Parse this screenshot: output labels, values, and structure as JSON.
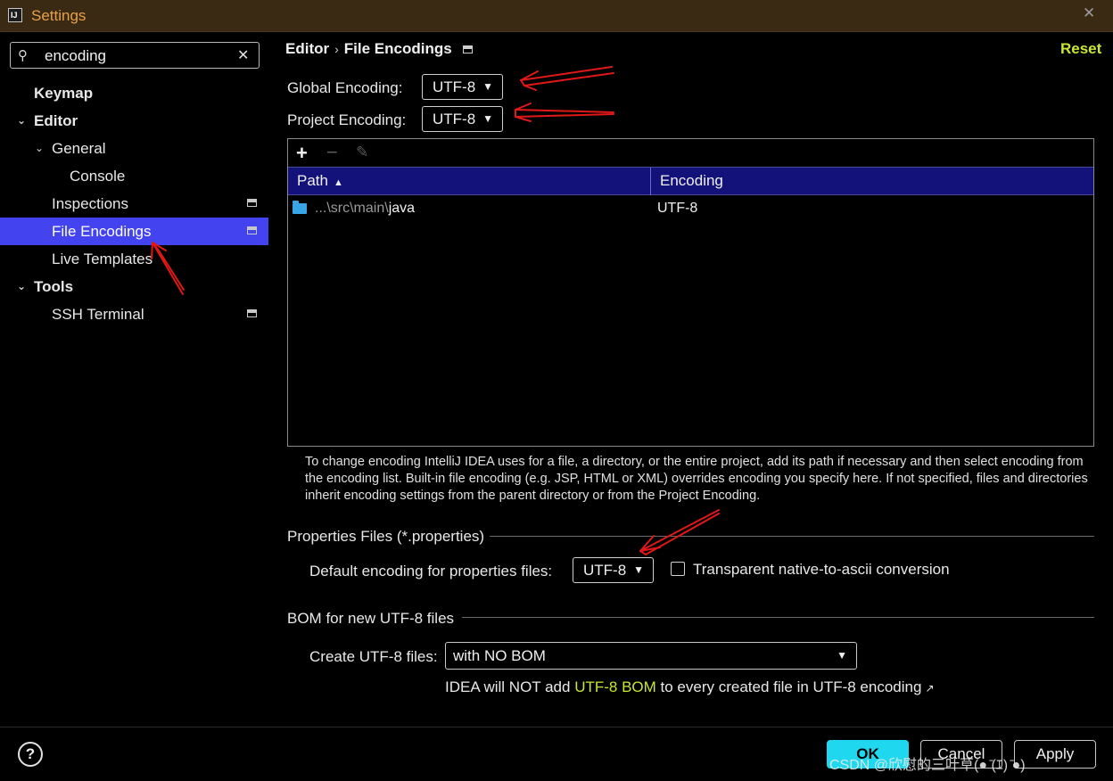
{
  "window": {
    "title": "Settings",
    "app_icon_text": "IJ",
    "close_glyph": "✕"
  },
  "search": {
    "value": "encoding"
  },
  "sidebar": {
    "items": [
      {
        "label": "Keymap"
      },
      {
        "label": "Editor"
      },
      {
        "label": "General"
      },
      {
        "label": "Console"
      },
      {
        "label": "Inspections"
      },
      {
        "label": "File Encodings"
      },
      {
        "label": "Live Templates"
      },
      {
        "label": "Tools"
      },
      {
        "label": "SSH Terminal"
      }
    ]
  },
  "header": {
    "breadcrumb": [
      "Editor",
      "File Encodings"
    ],
    "breadcrumb_separator": "›",
    "reset_label": "Reset"
  },
  "global_encoding": {
    "label": "Global Encoding:",
    "value": "UTF-8"
  },
  "project_encoding": {
    "label": "Project Encoding:",
    "value": "UTF-8"
  },
  "table": {
    "toolbar": {
      "add": "+",
      "remove": "−",
      "edit": "✎"
    },
    "columns": [
      "Path",
      "Encoding"
    ],
    "sort_indicator": "▲",
    "rows": [
      {
        "path_prefix": "...\\src\\main\\",
        "path_main": "java",
        "encoding": "UTF-8"
      }
    ]
  },
  "help_text": "To change encoding IntelliJ IDEA uses for a file, a directory, or the entire project, add its path if necessary and then select encoding from the encoding list. Built-in file encoding (e.g. JSP, HTML or XML) overrides encoding you specify here. If not specified, files and directories inherit encoding settings from the parent directory or from the Project Encoding.",
  "properties": {
    "section_title": "Properties Files (*.properties)",
    "default_label": "Default encoding for properties files:",
    "default_value": "UTF-8",
    "transparent_label": "Transparent native-to-ascii conversion",
    "transparent_checked": false
  },
  "bom": {
    "section_title": "BOM for new UTF-8 files",
    "create_label": "Create UTF-8 files:",
    "create_value": "with NO BOM",
    "note_before": "IDEA will NOT add ",
    "note_highlight": "UTF-8 BOM",
    "note_after": " to every created file in UTF-8 encoding",
    "note_arrow": "↗"
  },
  "footer": {
    "help_label": "?",
    "ok_label": "OK",
    "cancel_label": "Cancel",
    "apply_label": "Apply",
    "watermark": "CSDN @欣慰的三叶草(● ̄(ｴ) ̄●)"
  },
  "colors": {
    "selection": "#4343f0",
    "accent_green": "#c8e636",
    "ok_button": "#1fd8f0",
    "title_text": "#e8a04a",
    "annotation_arrows": "#e01818"
  }
}
